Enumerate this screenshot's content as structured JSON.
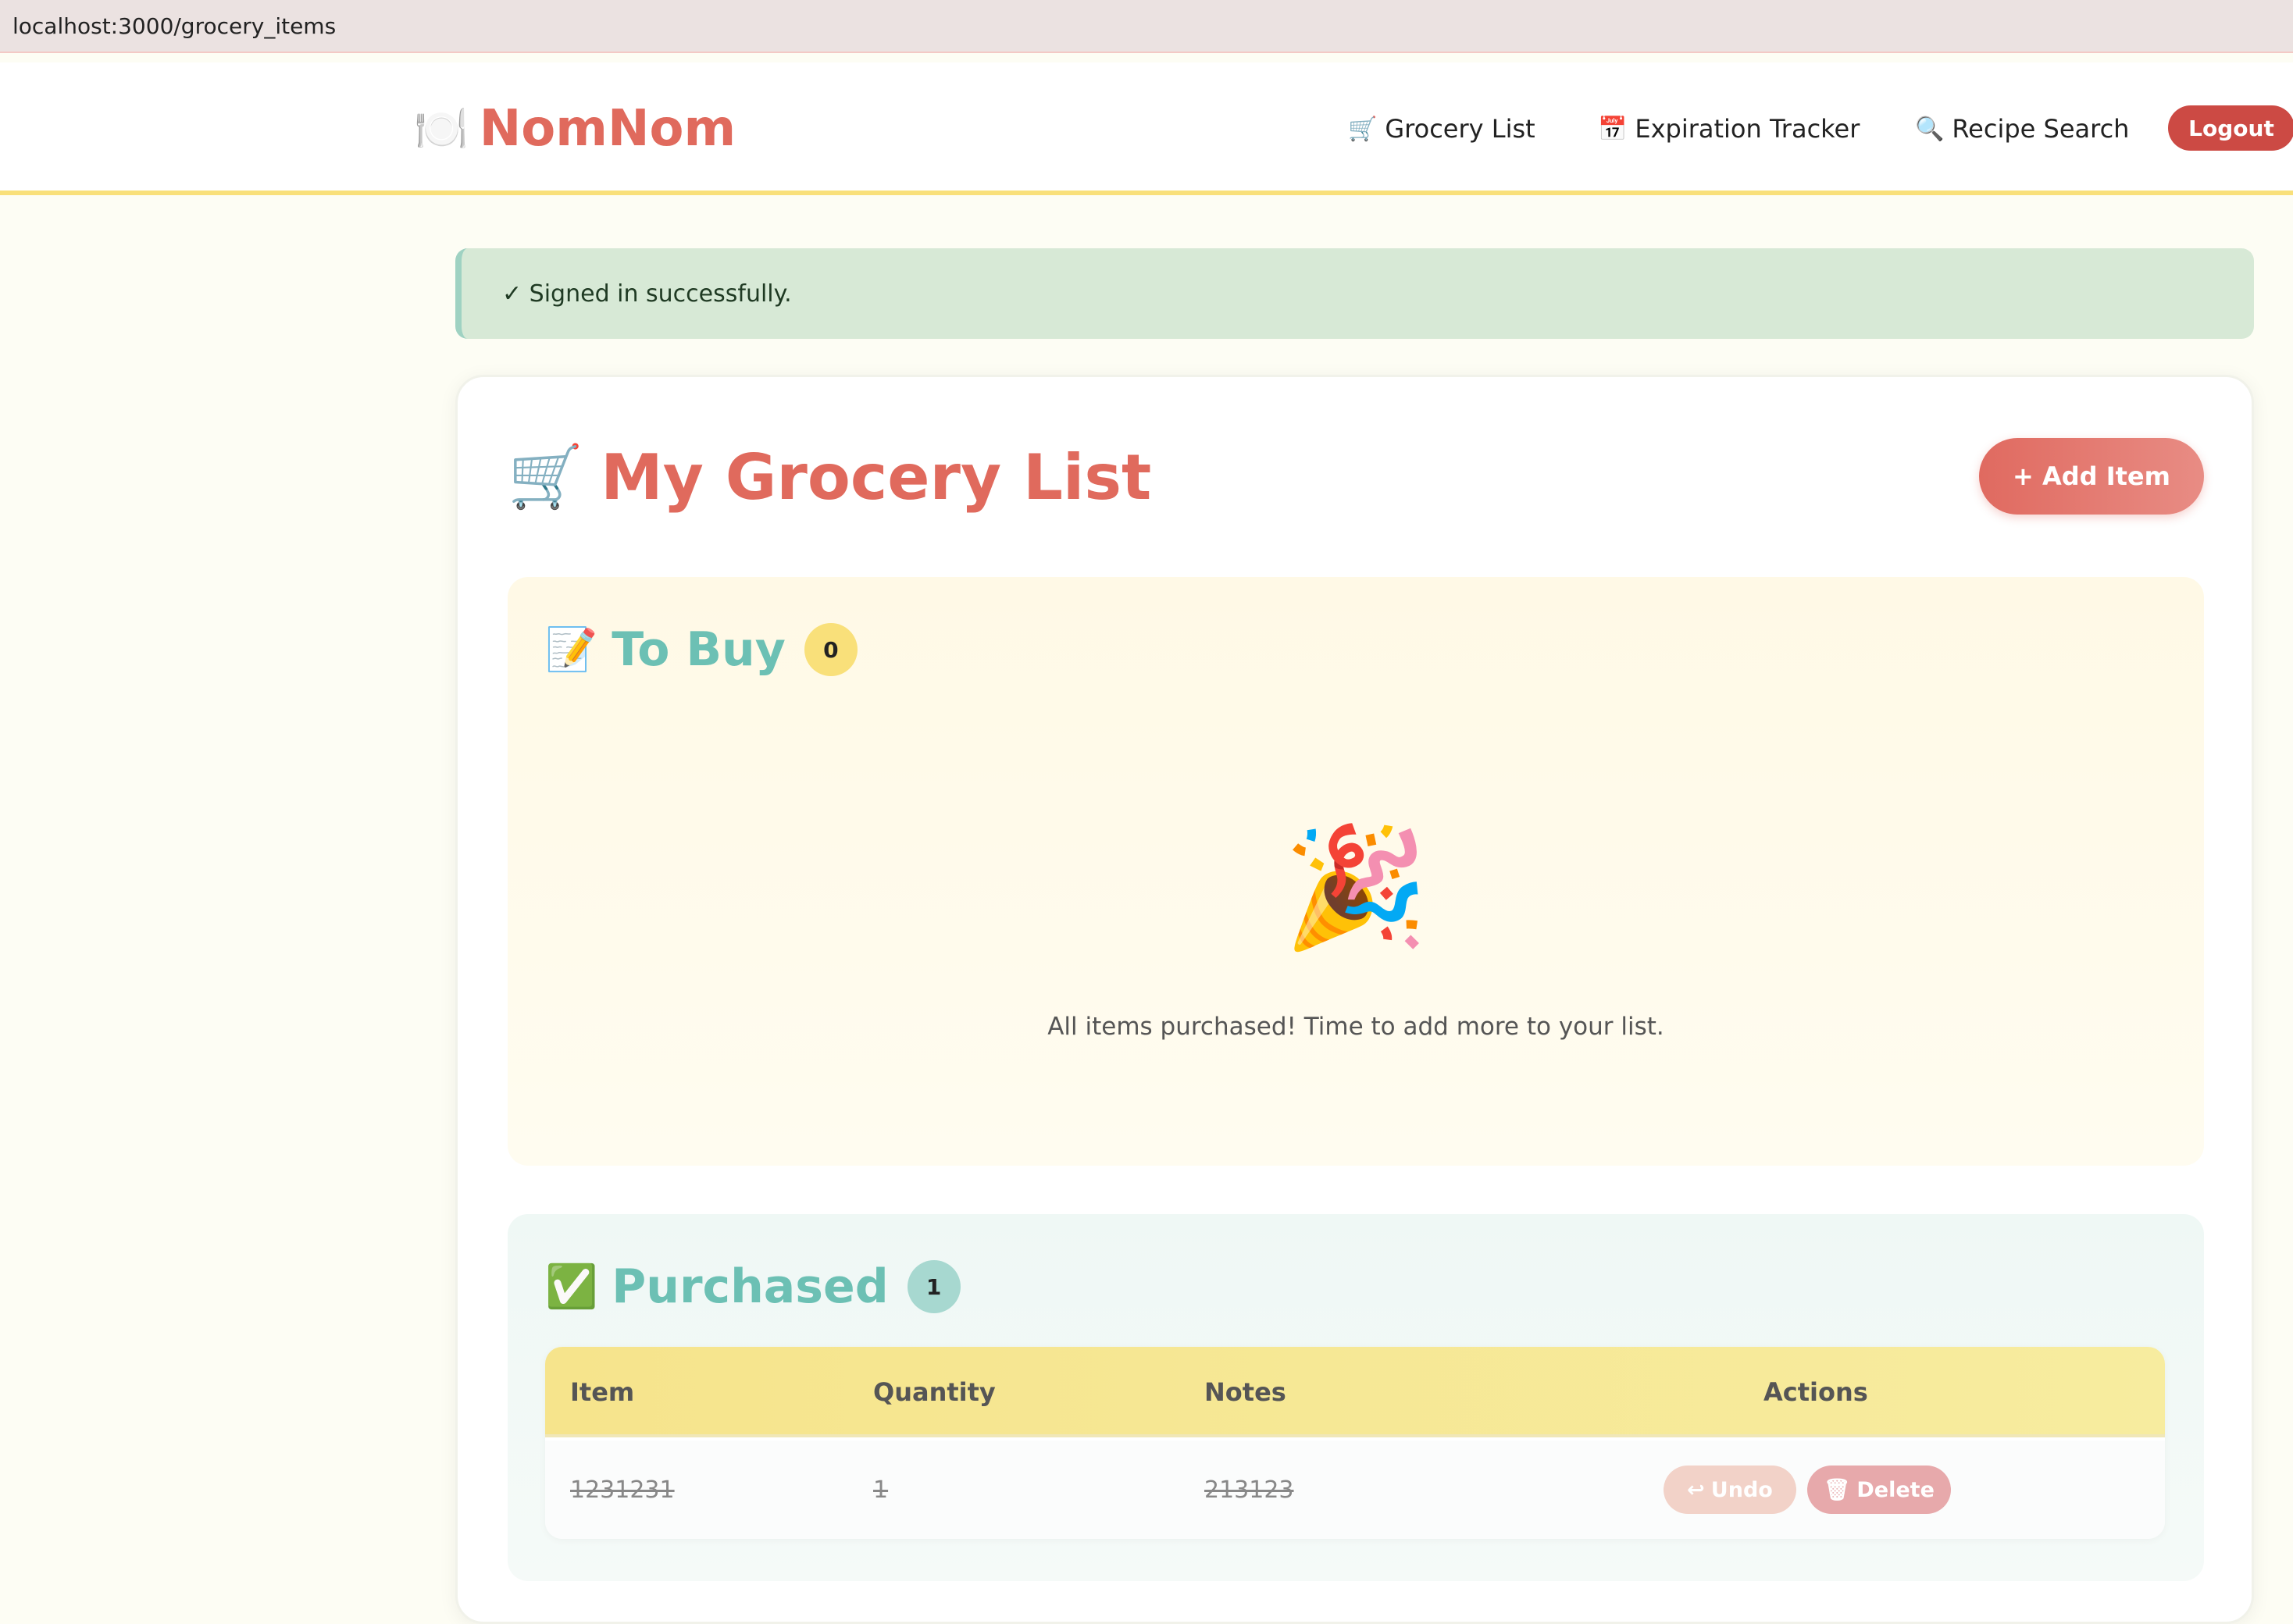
{
  "browser": {
    "url": "localhost:3000/grocery_items"
  },
  "nav": {
    "brand": "NomNom",
    "brand_icon": "🍽️",
    "links": [
      {
        "icon": "🛒",
        "label": "Grocery List"
      },
      {
        "icon": "📅",
        "label": "Expiration Tracker"
      },
      {
        "icon": "🔍",
        "label": "Recipe Search"
      }
    ],
    "logout": "Logout"
  },
  "flash": {
    "message": "✓ Signed in successfully."
  },
  "page": {
    "title_icon": "🛒",
    "title": "My Grocery List",
    "add_button": "+ Add Item"
  },
  "to_buy": {
    "icon": "📝",
    "title": "To Buy",
    "count": "0",
    "empty_emoji": "🎉",
    "empty_text": "All items purchased! Time to add more to your list."
  },
  "purchased": {
    "icon": "✅",
    "title": "Purchased",
    "count": "1",
    "columns": [
      "Item",
      "Quantity",
      "Notes",
      "Actions"
    ],
    "rows": [
      {
        "item": "1231231",
        "quantity": "1",
        "notes": "213123",
        "undo": "Undo",
        "delete": "Delete"
      }
    ]
  },
  "colors": {
    "accent": "#e06a5d",
    "teal": "#6cc0b4",
    "yellow": "#f9e07a",
    "logout": "#cc4a44"
  }
}
